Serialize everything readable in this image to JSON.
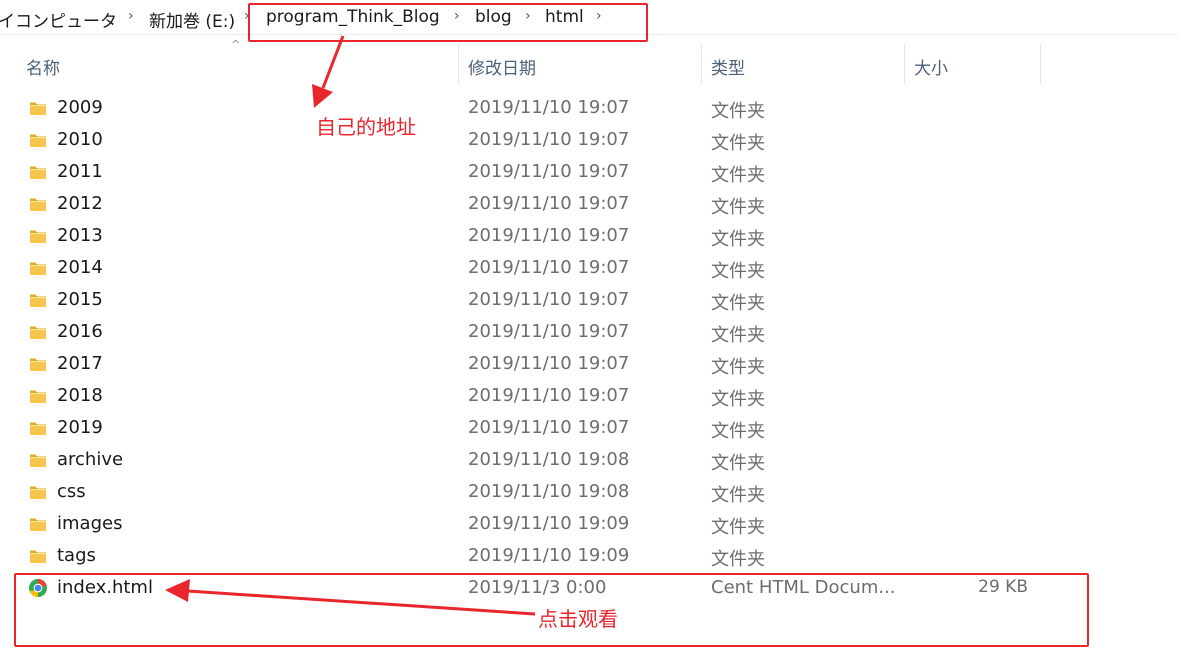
{
  "breadcrumb": {
    "items": [
      "イコンピュータ",
      "新加巻 (E:)",
      "program_Think_Blog",
      "blog",
      "html"
    ]
  },
  "columns": {
    "name": "名称",
    "modified": "修改日期",
    "type": "类型",
    "size": "大小"
  },
  "rows": [
    {
      "name": "2009",
      "date": "2019/11/10 19:07",
      "type": "文件夹",
      "size": ""
    },
    {
      "name": "2010",
      "date": "2019/11/10 19:07",
      "type": "文件夹",
      "size": ""
    },
    {
      "name": "2011",
      "date": "2019/11/10 19:07",
      "type": "文件夹",
      "size": ""
    },
    {
      "name": "2012",
      "date": "2019/11/10 19:07",
      "type": "文件夹",
      "size": ""
    },
    {
      "name": "2013",
      "date": "2019/11/10 19:07",
      "type": "文件夹",
      "size": ""
    },
    {
      "name": "2014",
      "date": "2019/11/10 19:07",
      "type": "文件夹",
      "size": ""
    },
    {
      "name": "2015",
      "date": "2019/11/10 19:07",
      "type": "文件夹",
      "size": ""
    },
    {
      "name": "2016",
      "date": "2019/11/10 19:07",
      "type": "文件夹",
      "size": ""
    },
    {
      "name": "2017",
      "date": "2019/11/10 19:07",
      "type": "文件夹",
      "size": ""
    },
    {
      "name": "2018",
      "date": "2019/11/10 19:07",
      "type": "文件夹",
      "size": ""
    },
    {
      "name": "2019",
      "date": "2019/11/10 19:07",
      "type": "文件夹",
      "size": ""
    },
    {
      "name": "archive",
      "date": "2019/11/10 19:08",
      "type": "文件夹",
      "size": ""
    },
    {
      "name": "css",
      "date": "2019/11/10 19:08",
      "type": "文件夹",
      "size": ""
    },
    {
      "name": "images",
      "date": "2019/11/10 19:09",
      "type": "文件夹",
      "size": ""
    },
    {
      "name": "tags",
      "date": "2019/11/10 19:09",
      "type": "文件夹",
      "size": ""
    },
    {
      "name": "index.html",
      "date": "2019/11/3 0:00",
      "type": "Cent HTML Docum...",
      "size": "29 KB"
    }
  ],
  "annotations": {
    "address_note": "自己的地址",
    "click_note": "点击观看"
  },
  "colors": {
    "annotation_red": "#e8262b",
    "folder_yellow": "#f8c64c",
    "header_text": "#4c607a"
  },
  "icons": {
    "folder": "folder-icon",
    "html_file": "browser-html-icon",
    "breadcrumb_separator": "chevron-right-icon",
    "sort": "sort-up-icon"
  }
}
